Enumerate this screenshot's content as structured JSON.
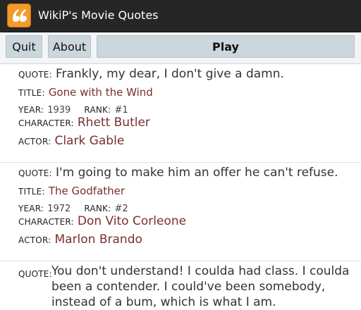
{
  "app": {
    "title": "WikiP's Movie Quotes"
  },
  "toolbar": {
    "quit": "Quit",
    "about": "About",
    "play": "Play"
  },
  "labels": {
    "quote": "QUOTE:",
    "title": "TITLE:",
    "year": "YEAR:",
    "rank": "RANK:",
    "character": "CHARACTER:",
    "actor": "ACTOR:"
  },
  "quotes": [
    {
      "quote": "Frankly, my dear, I don't give a damn.",
      "title": "Gone with the Wind",
      "year": "1939",
      "rank": "#1",
      "character": "Rhett Butler",
      "actor": "Clark Gable"
    },
    {
      "quote": "I'm going to make him an offer he can't refuse.",
      "title": "The Godfather",
      "year": "1972",
      "rank": "#2",
      "character": "Don Vito Corleone",
      "actor": "Marlon Brando"
    },
    {
      "quote": "You don't understand! I coulda had class. I coulda been a contender. I could've been somebody, instead of a bum, which is what I am."
    }
  ]
}
